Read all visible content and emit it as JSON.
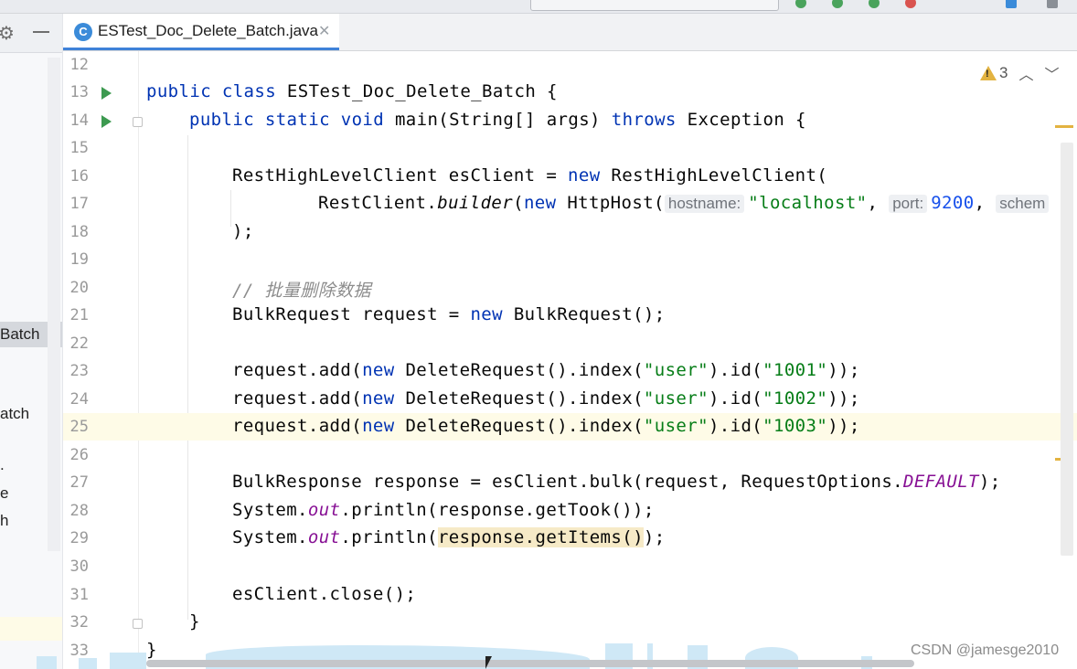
{
  "tab": {
    "filename": "ESTest_Doc_Delete_Batch.java",
    "icon": "C"
  },
  "project_tree": {
    "selected_item": "Batch",
    "item2": "atch",
    "item3": ".",
    "item4": "e",
    "item5": "h"
  },
  "inspection": {
    "warnings_count": "3"
  },
  "hints": {
    "hostname": "hostname:",
    "port": "port:",
    "scheme": "schem"
  },
  "code": {
    "l12": "",
    "l13_kw": "public class ",
    "l13_name": "ESTest_Doc_Delete_Batch {",
    "l14_kw1": "public static void ",
    "l14_a": "main(String[] args) ",
    "l14_kw2": "throws",
    "l14_b": " Exception {",
    "l16_a": "RestHighLevelClient esClient = ",
    "l16_kw": "new",
    "l16_b": " RestHighLevelClient(",
    "l17_a": "RestClient.",
    "l17_m": "builder",
    "l17_b": "(",
    "l17_kw": "new",
    "l17_c": " HttpHost(",
    "l17_s": "\"localhost\"",
    "l17_d": ", ",
    "l17_n": "9200",
    "l17_e": ", ",
    "l18": ");",
    "l20": "// 批量删除数据",
    "l21_a": "BulkRequest request = ",
    "l21_kw": "new",
    "l21_b": " BulkRequest();",
    "l23_a": "request.add(",
    "l23_kw": "new",
    "l23_b": " DeleteRequest().index(",
    "l23_s1": "\"user\"",
    "l23_c": ").id(",
    "l23_s2": "\"1001\"",
    "l23_d": "));",
    "l24_s2": "\"1002\"",
    "l25_s2": "\"1003\"",
    "l27_a": "BulkResponse response = esClient.bulk(request, RequestOptions.",
    "l27_st": "DEFAULT",
    "l27_b": ");",
    "l28_a": "System.",
    "l28_st": "out",
    "l28_b": ".println(response.getTook());",
    "l29_a": "System.",
    "l29_st": "out",
    "l29_b": ".println(",
    "l29_m": "response.getItems()",
    "l29_c": ");",
    "l31": "esClient.close();",
    "l32": "}",
    "l33": "}"
  },
  "line_numbers": [
    "12",
    "13",
    "14",
    "15",
    "16",
    "17",
    "18",
    "19",
    "20",
    "21",
    "22",
    "23",
    "24",
    "25",
    "26",
    "27",
    "28",
    "29",
    "30",
    "31",
    "32",
    "33"
  ],
  "watermark": "CSDN @jamesge2010",
  "colors": {
    "keyword": "#0033b3",
    "string": "#067d17",
    "number": "#1750eb",
    "comment": "#8c8c8c",
    "static": "#871094",
    "caret_line": "#fefbe7",
    "tab_underline": "#3f82d8",
    "run_icon": "#3d9a50",
    "warning": "#e3b341"
  }
}
